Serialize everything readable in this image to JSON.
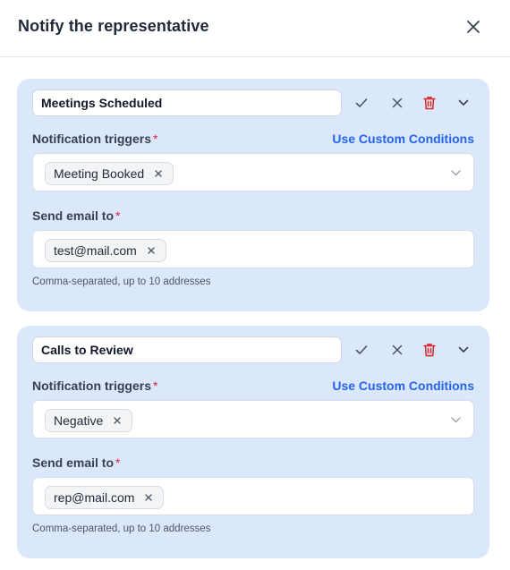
{
  "dialog": {
    "title": "Notify the representative"
  },
  "cards": [
    {
      "name": "Meetings Scheduled",
      "triggers_label": "Notification triggers",
      "custom_conditions_link": "Use Custom Conditions",
      "trigger_chip": "Meeting Booked",
      "email_label": "Send email to",
      "email_chip": "test@mail.com",
      "hint": "Comma-separated, up to 10 addresses"
    },
    {
      "name": "Calls to Review",
      "triggers_label": "Notification triggers",
      "custom_conditions_link": "Use Custom Conditions",
      "trigger_chip": "Negative",
      "email_label": "Send email to",
      "email_chip": "rep@mail.com",
      "hint": "Comma-separated, up to 10 addresses"
    }
  ],
  "required_marker": "*",
  "icons": {
    "close": "close-icon",
    "confirm": "check-icon",
    "cancel": "x-icon",
    "delete": "trash-icon",
    "collapse": "chevron-down-icon"
  },
  "colors": {
    "card_background": "#dbe8fc",
    "link": "#2563eb",
    "delete_icon": "#dc2626",
    "required": "#e11d48"
  }
}
